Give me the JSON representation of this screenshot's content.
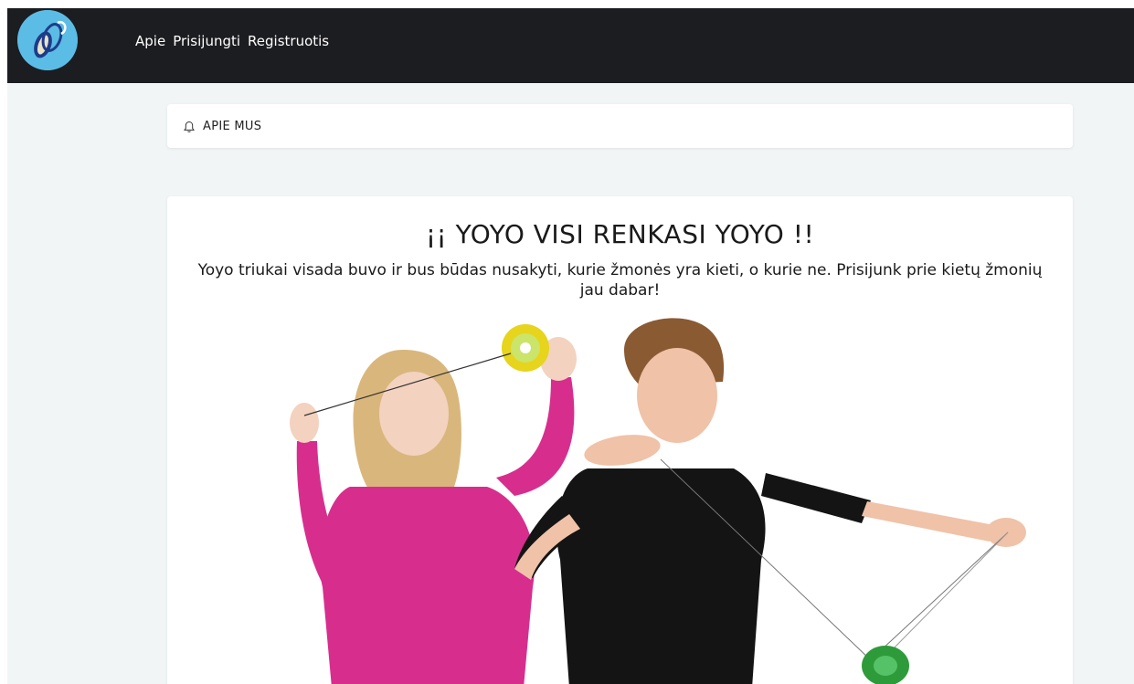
{
  "navbar": {
    "logo_icon": "yoyo-logo-icon",
    "links": [
      "Apie",
      "Prisijungti",
      "Registruotis"
    ]
  },
  "about_card": {
    "icon": "bell-icon",
    "label": "APIE MUS"
  },
  "hero": {
    "title": "¡¡ YOYO VISI RENKASI YOYO !!",
    "subtitle": "Yoyo triukai visada buvo ir bus būdas nusakyti, kurie žmonės yra kieti, o kurie ne. Prisijunk prie kietų žmonių jau dabar!",
    "image": "kids-playing-yoyo-photo"
  },
  "colors": {
    "navbar_bg": "#1c1d21",
    "page_bg": "#f1f5f5",
    "card_bg": "#ffffff",
    "logo_blue": "#4bb3e0"
  }
}
